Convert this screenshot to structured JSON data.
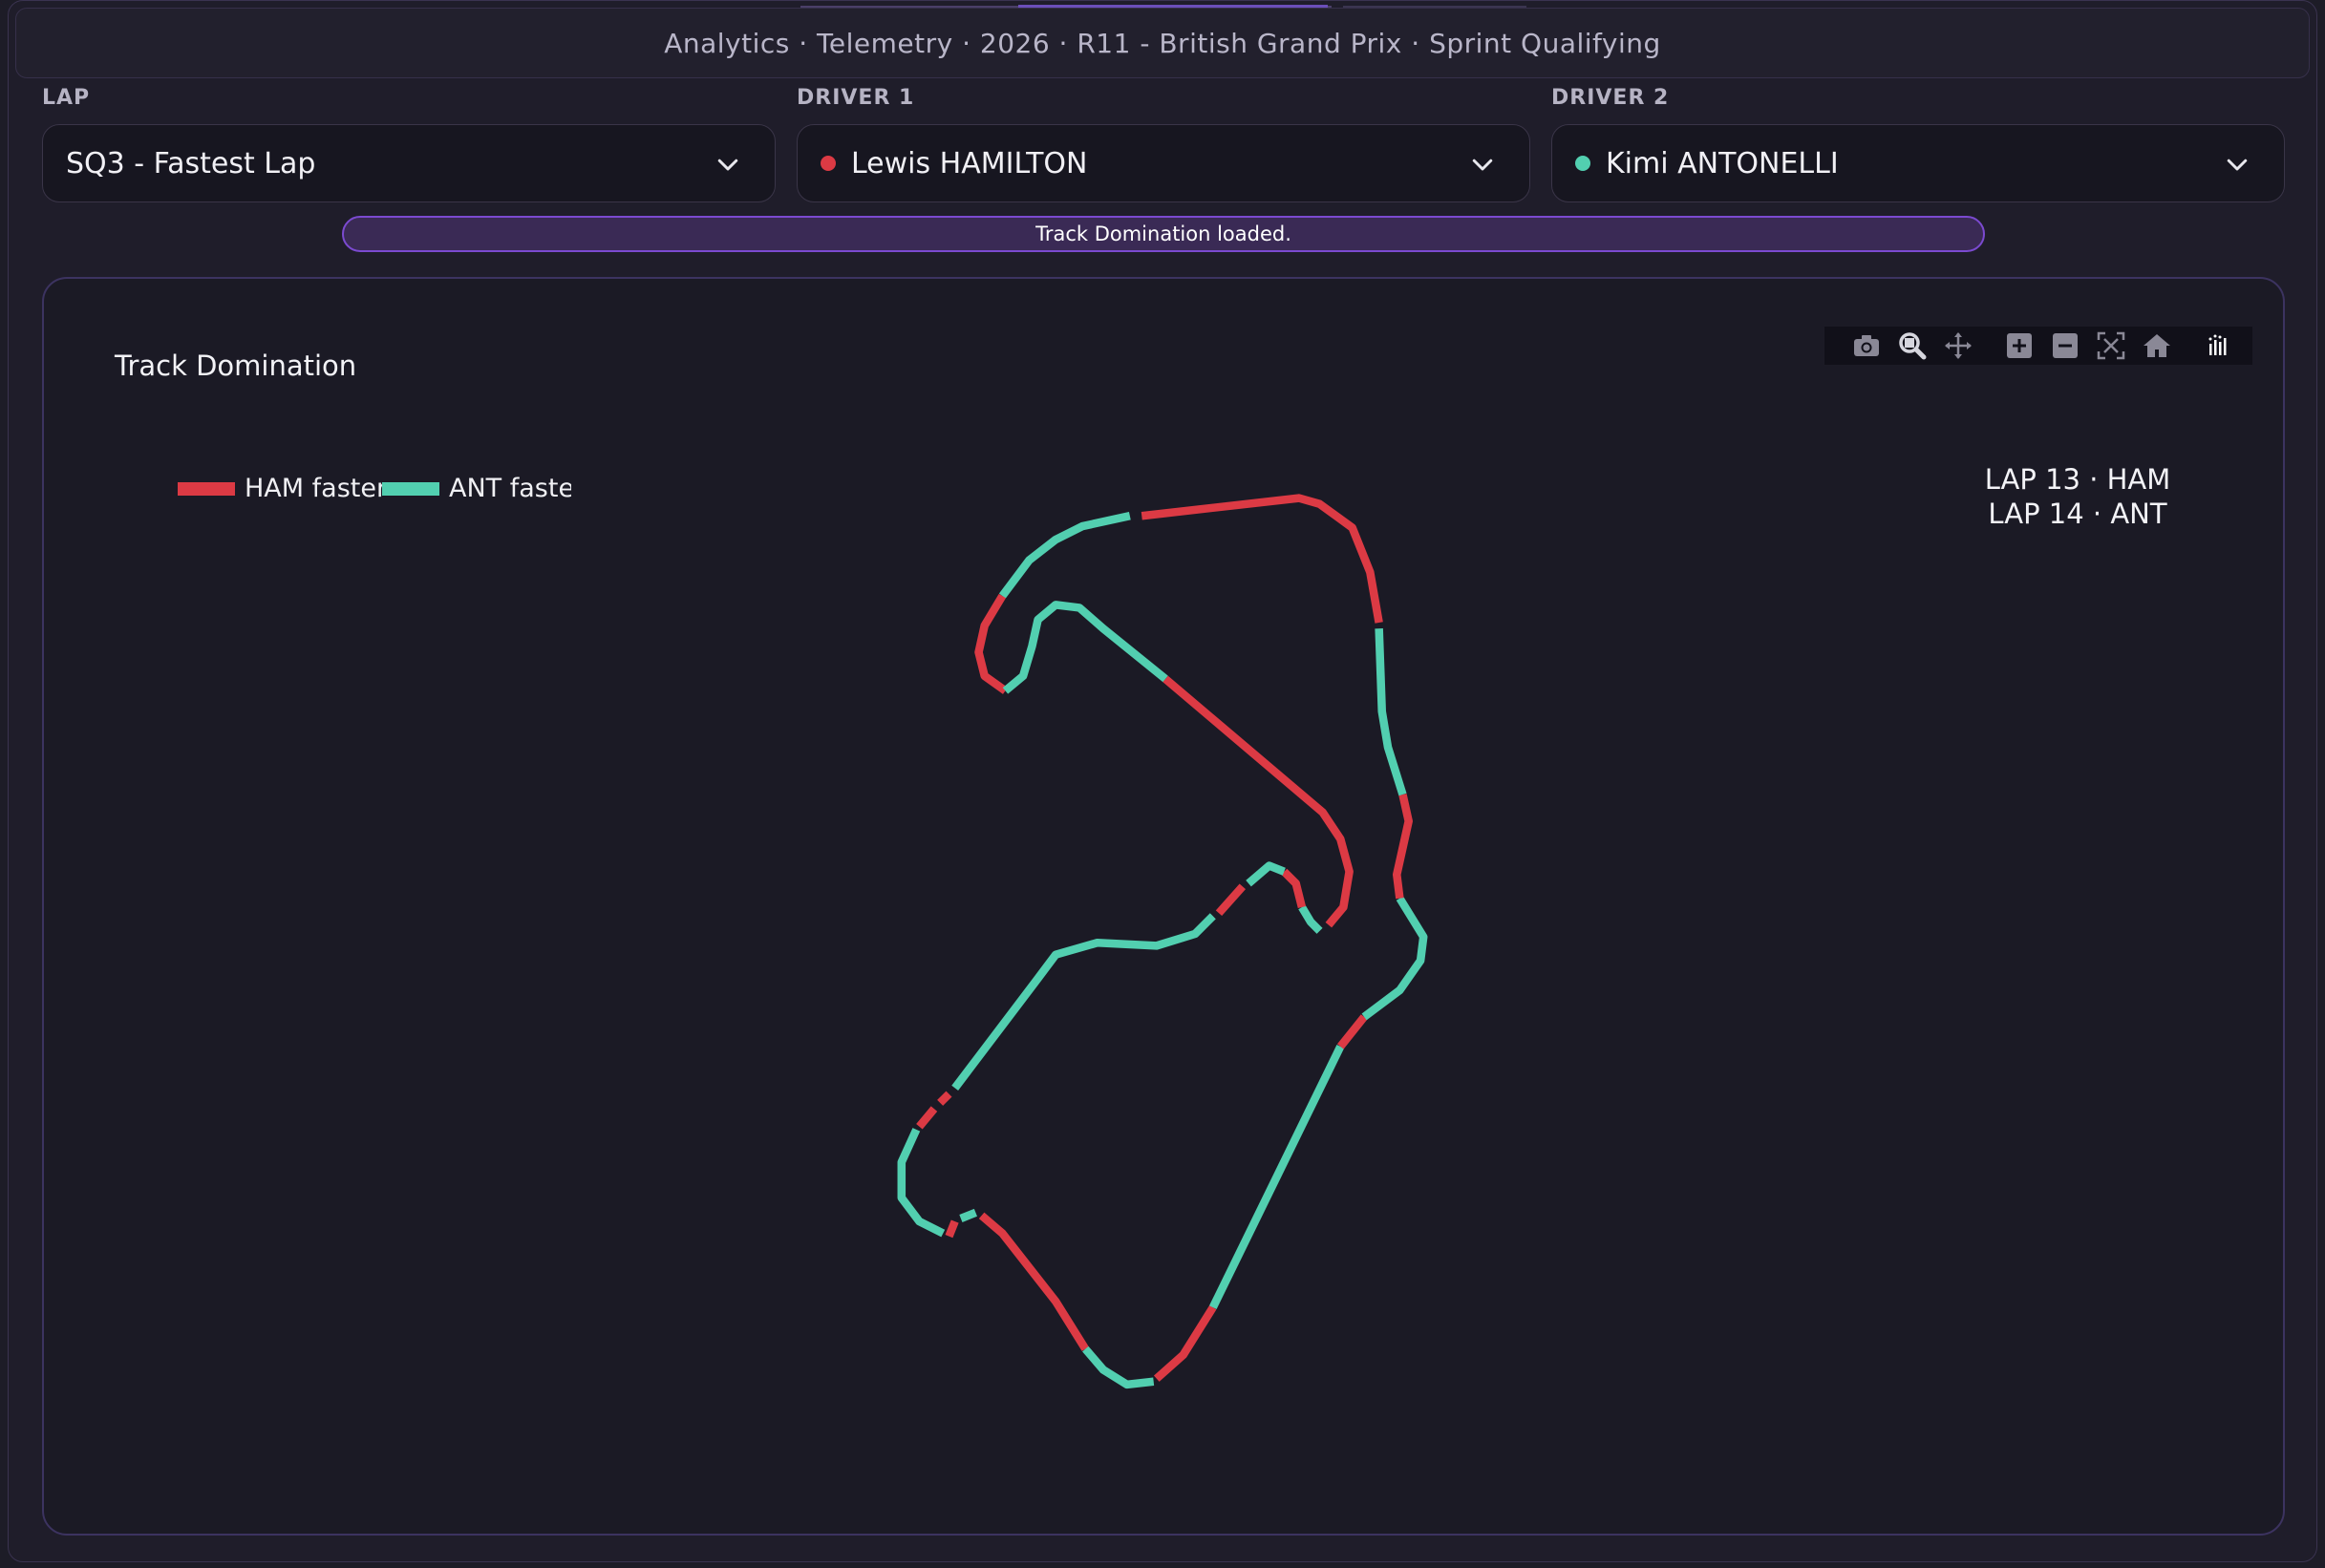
{
  "header": {
    "title": "Analytics · Telemetry · 2026 · R11 - British Grand Prix · Sprint Qualifying"
  },
  "filters": {
    "lap": {
      "label": "LAP",
      "value": "SQ3 - Fastest Lap"
    },
    "driver1": {
      "label": "DRIVER 1",
      "value": "Lewis HAMILTON",
      "color": "#dc3a44"
    },
    "driver2": {
      "label": "DRIVER 2",
      "value": "Kimi ANTONELLI",
      "color": "#52cfb0"
    }
  },
  "status": {
    "message": "Track Domination loaded."
  },
  "chart": {
    "title": "Track Domination",
    "legend": [
      {
        "label": "HAM faster",
        "color": "#dc3a44"
      },
      {
        "label": "ANT faster",
        "color": "#52cfb0"
      }
    ],
    "lap_info": [
      "LAP 13 · HAM",
      "LAP 14 · ANT"
    ],
    "toolbar_icons": [
      "camera-icon",
      "zoom-icon",
      "pan-icon",
      "zoom-in-icon",
      "zoom-out-icon",
      "autoscale-icon",
      "reset-axes-icon",
      "plotly-logo-icon"
    ]
  },
  "chart_data": {
    "type": "line",
    "title": "Track Domination",
    "series": [
      {
        "name": "HAM faster",
        "color": "#dc3a44"
      },
      {
        "name": "ANT faster",
        "color": "#52cfb0"
      }
    ],
    "segments": [
      {
        "driver": "ANT",
        "pts": [
          [
            762,
            348
          ],
          [
            730,
            355
          ],
          [
            712,
            364
          ],
          [
            694,
            378
          ],
          [
            676,
            402
          ]
        ]
      },
      {
        "driver": "HAM",
        "pts": [
          [
            676,
            402
          ],
          [
            664,
            422
          ],
          [
            660,
            440
          ],
          [
            664,
            456
          ],
          [
            678,
            466
          ]
        ]
      },
      {
        "driver": "ANT",
        "pts": [
          [
            678,
            466
          ],
          [
            690,
            456
          ],
          [
            696,
            436
          ],
          [
            700,
            418
          ],
          [
            712,
            408
          ],
          [
            728,
            410
          ],
          [
            744,
            424
          ],
          [
            786,
            458
          ]
        ]
      },
      {
        "driver": "HAM",
        "pts": [
          [
            786,
            458
          ],
          [
            892,
            548
          ],
          [
            904,
            566
          ],
          [
            910,
            588
          ],
          [
            906,
            612
          ],
          [
            896,
            624
          ]
        ]
      },
      {
        "driver": "ANT",
        "pts": [
          [
            890,
            628
          ],
          [
            884,
            622
          ],
          [
            878,
            612
          ]
        ]
      },
      {
        "driver": "HAM",
        "pts": [
          [
            878,
            612
          ],
          [
            874,
            596
          ],
          [
            866,
            588
          ]
        ]
      },
      {
        "driver": "ANT",
        "pts": [
          [
            866,
            588
          ],
          [
            856,
            584
          ],
          [
            842,
            596
          ]
        ]
      },
      {
        "driver": "HAM",
        "pts": [
          [
            838,
            598
          ],
          [
            822,
            616
          ]
        ]
      },
      {
        "driver": "ANT",
        "pts": [
          [
            818,
            618
          ],
          [
            806,
            630
          ],
          [
            780,
            638
          ],
          [
            740,
            636
          ],
          [
            712,
            644
          ],
          [
            700,
            660
          ],
          [
            644,
            734
          ]
        ]
      },
      {
        "driver": "HAM",
        "pts": [
          [
            640,
            738
          ],
          [
            634,
            744
          ]
        ]
      },
      {
        "driver": "HAM",
        "pts": [
          [
            630,
            748
          ],
          [
            620,
            760
          ]
        ]
      },
      {
        "driver": "ANT",
        "pts": [
          [
            618,
            762
          ],
          [
            608,
            784
          ],
          [
            608,
            808
          ],
          [
            620,
            824
          ],
          [
            636,
            832
          ]
        ]
      },
      {
        "driver": "HAM",
        "pts": [
          [
            640,
            834
          ],
          [
            644,
            824
          ]
        ]
      },
      {
        "driver": "ANT",
        "pts": [
          [
            648,
            822
          ],
          [
            658,
            818
          ]
        ]
      },
      {
        "driver": "HAM",
        "pts": [
          [
            662,
            820
          ],
          [
            676,
            832
          ],
          [
            712,
            878
          ],
          [
            732,
            910
          ]
        ]
      },
      {
        "driver": "ANT",
        "pts": [
          [
            732,
            910
          ],
          [
            744,
            924
          ],
          [
            760,
            934
          ],
          [
            778,
            932
          ]
        ]
      },
      {
        "driver": "HAM",
        "pts": [
          [
            780,
            930
          ],
          [
            798,
            914
          ],
          [
            818,
            882
          ]
        ]
      },
      {
        "driver": "ANT",
        "pts": [
          [
            818,
            882
          ],
          [
            904,
            706
          ]
        ]
      },
      {
        "driver": "HAM",
        "pts": [
          [
            904,
            706
          ],
          [
            920,
            686
          ]
        ]
      },
      {
        "driver": "ANT",
        "pts": [
          [
            920,
            686
          ],
          [
            944,
            668
          ],
          [
            958,
            648
          ],
          [
            960,
            632
          ],
          [
            944,
            606
          ]
        ]
      },
      {
        "driver": "HAM",
        "pts": [
          [
            944,
            606
          ],
          [
            942,
            590
          ],
          [
            950,
            554
          ],
          [
            946,
            536
          ]
        ]
      },
      {
        "driver": "ANT",
        "pts": [
          [
            946,
            536
          ],
          [
            936,
            504
          ],
          [
            932,
            480
          ],
          [
            930,
            424
          ]
        ]
      },
      {
        "driver": "HAM",
        "pts": [
          [
            930,
            420
          ],
          [
            924,
            386
          ],
          [
            912,
            356
          ],
          [
            890,
            340
          ],
          [
            876,
            336
          ],
          [
            770,
            348
          ]
        ]
      }
    ]
  }
}
